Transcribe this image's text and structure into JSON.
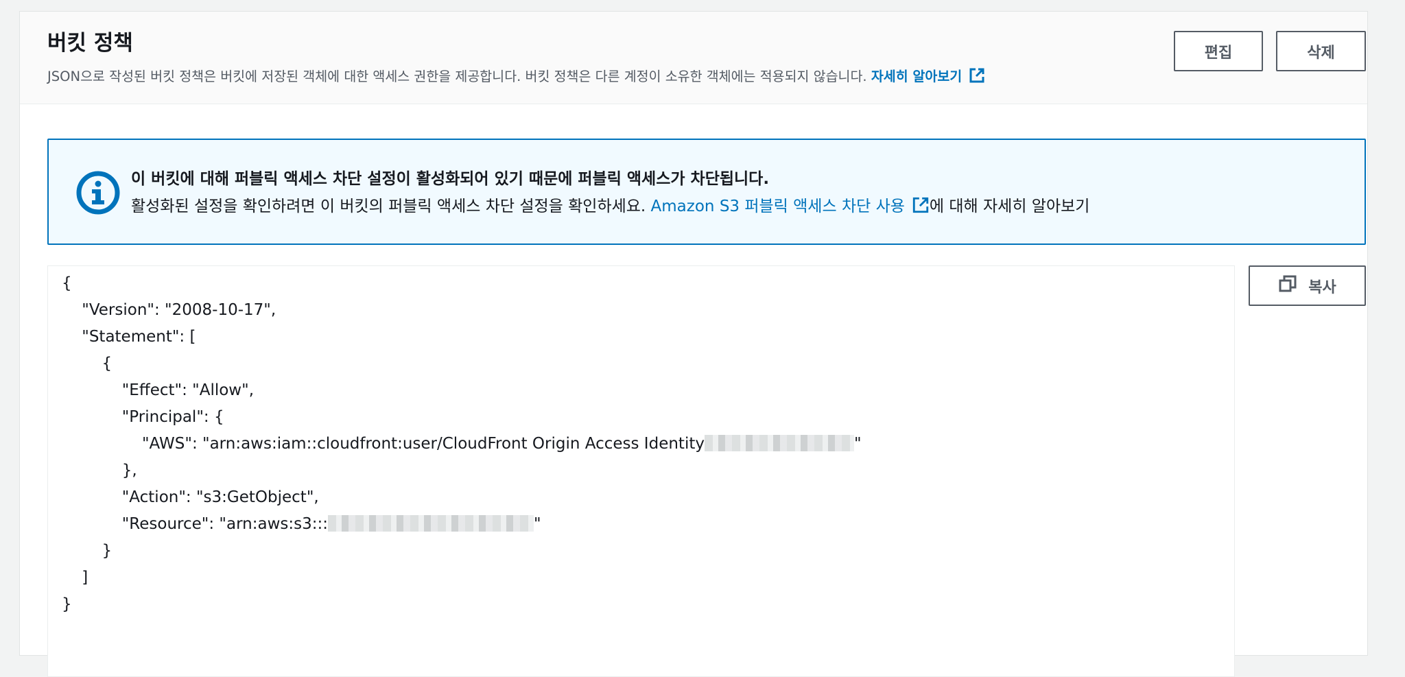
{
  "header": {
    "title": "버킷 정책",
    "description": "JSON으로 작성된 버킷 정책은 버킷에 저장된 객체에 대한 액세스 권한을 제공합니다. 버킷 정책은 다른 계정이 소유한 객체에는 적용되지 않습니다. ",
    "learn_more_link": "자세히 알아보기",
    "edit_button": "편집",
    "delete_button": "삭제"
  },
  "alert": {
    "icon": "info-icon",
    "title": "이 버킷에 대해 퍼블릭 액세스 차단 설정이 활성화되어 있기 때문에 퍼블릭 액세스가 차단됩니다.",
    "body_prefix": "활성화된 설정을 확인하려면 이 버킷의 퍼블릭 액세스 차단 설정을 확인하세요. ",
    "link_text": "Amazon S3 퍼블릭 액세스 차단 사용",
    "body_suffix": "에 대해 자세히 알아보기"
  },
  "policy": {
    "lines": [
      "{",
      "    \"Version\": \"2008-10-17\",",
      "    \"Statement\": [",
      "        {",
      "            \"Effect\": \"Allow\",",
      "            \"Principal\": {",
      "                \"AWS\": \"arn:aws:iam::cloudfront:user/CloudFront Origin Access Identity",
      "            },",
      "            \"Action\": \"s3:GetObject\",",
      "            \"Resource\": \"arn:aws:s3:::",
      "        }",
      "    ]",
      "}"
    ],
    "redacted_closing": "\""
  },
  "copy_button": "복사",
  "colors": {
    "accent": "#0073bb",
    "alert_bg": "#f1faff",
    "page_bg": "#f2f3f3"
  }
}
